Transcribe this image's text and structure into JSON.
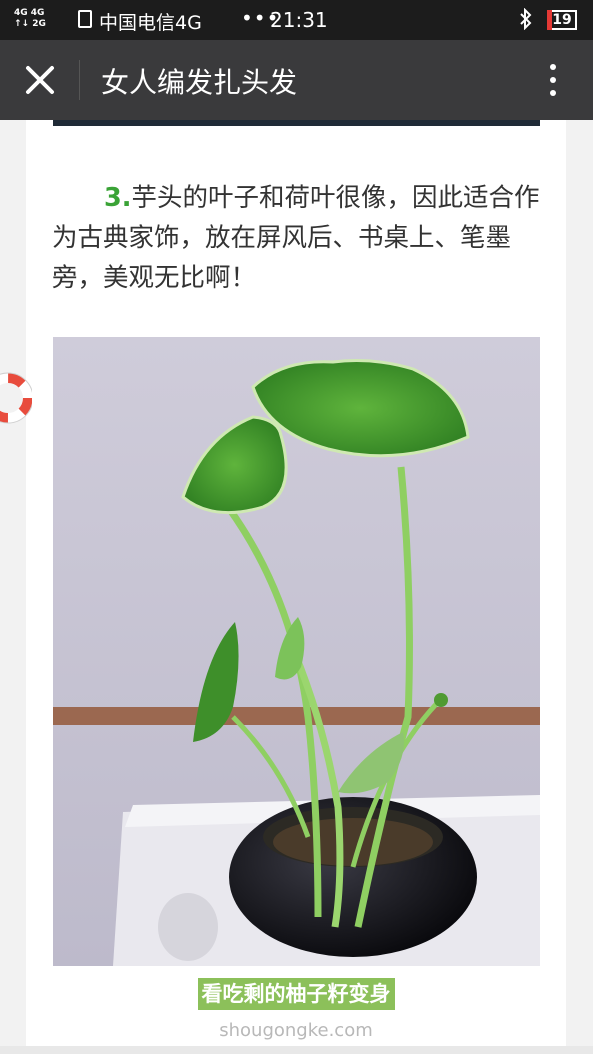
{
  "status_bar": {
    "network_top": "4G 4G",
    "network_bottom": "↑↓ 2G",
    "carrier": "中国电信4G",
    "dots": "•••",
    "time": "21:31",
    "battery": "19",
    "icons": [
      "signal-icon",
      "sim-icon",
      "wifi-icon",
      "bluetooth-icon",
      "battery-icon"
    ]
  },
  "title_bar": {
    "title": "女人编发扎头发",
    "close_label": "✕",
    "icons": [
      "close-icon",
      "more-vertical-icon"
    ]
  },
  "article": {
    "step_number": "3.",
    "paragraph": "芋头的叶子和荷叶很像，因此适合作为古典家饰，放在屏风后、书桌上、笔墨旁，美观无比啊！",
    "image_icon": "plant-photo",
    "caption": "看吃剩的柚子籽变身",
    "watermark": "shougongke.com"
  },
  "floating": {
    "icon": "life-buoy-icon"
  },
  "colors": {
    "status_bar_bg": "#1c1c1c",
    "title_bar_bg": "#3a3a3c",
    "step_number": "#3aa336",
    "caption_bg": "#8cc05a"
  }
}
